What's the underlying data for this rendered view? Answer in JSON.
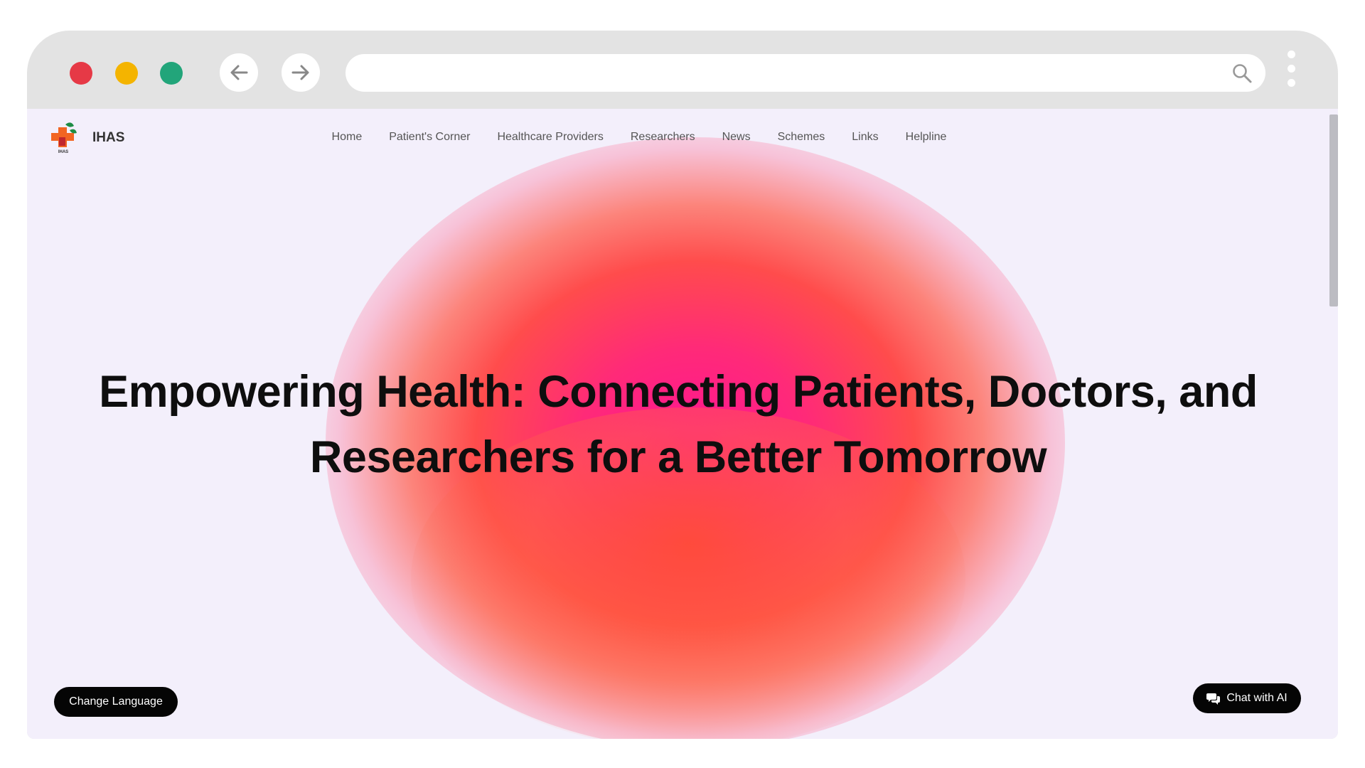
{
  "browser": {
    "url": "",
    "icons": [
      "close-dot",
      "minimize-dot",
      "maximize-dot",
      "back-arrow-icon",
      "forward-arrow-icon",
      "search-icon",
      "kebab-menu-icon"
    ]
  },
  "site": {
    "brand": "IHAS",
    "logo_caption": "IHAS",
    "nav": [
      "Home",
      "Patient's Corner",
      "Healthcare Providers",
      "Researchers",
      "News",
      "Schemes",
      "Links",
      "Helpline"
    ]
  },
  "hero": {
    "line1": "Empowering Health: Connecting Patients, Doctors, and",
    "line2": "Researchers for a Better Tomorrow"
  },
  "buttons": {
    "change_language": "Change Language",
    "chat_ai": "Chat with AI"
  },
  "colors": {
    "accent_pink": "#ff1493",
    "accent_orange": "#ff4c4c",
    "button_bg": "#050505"
  }
}
